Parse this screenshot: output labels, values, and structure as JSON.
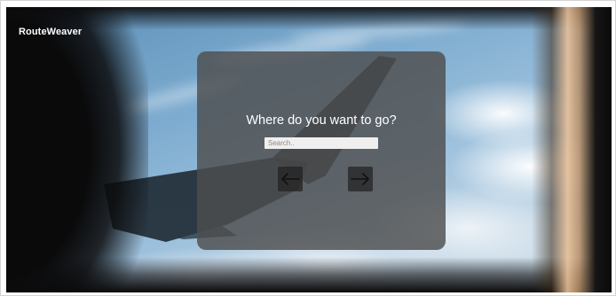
{
  "app": {
    "brand": "RouteWeaver"
  },
  "search": {
    "heading": "Where do you want to go?",
    "placeholder": "Search..",
    "value": ""
  },
  "navigation": {
    "prev_icon": "arrow-left-icon",
    "next_icon": "arrow-right-icon"
  },
  "colors": {
    "panel": "#4e4e4e",
    "text": "#ffffff",
    "input_bg": "#efefef"
  }
}
